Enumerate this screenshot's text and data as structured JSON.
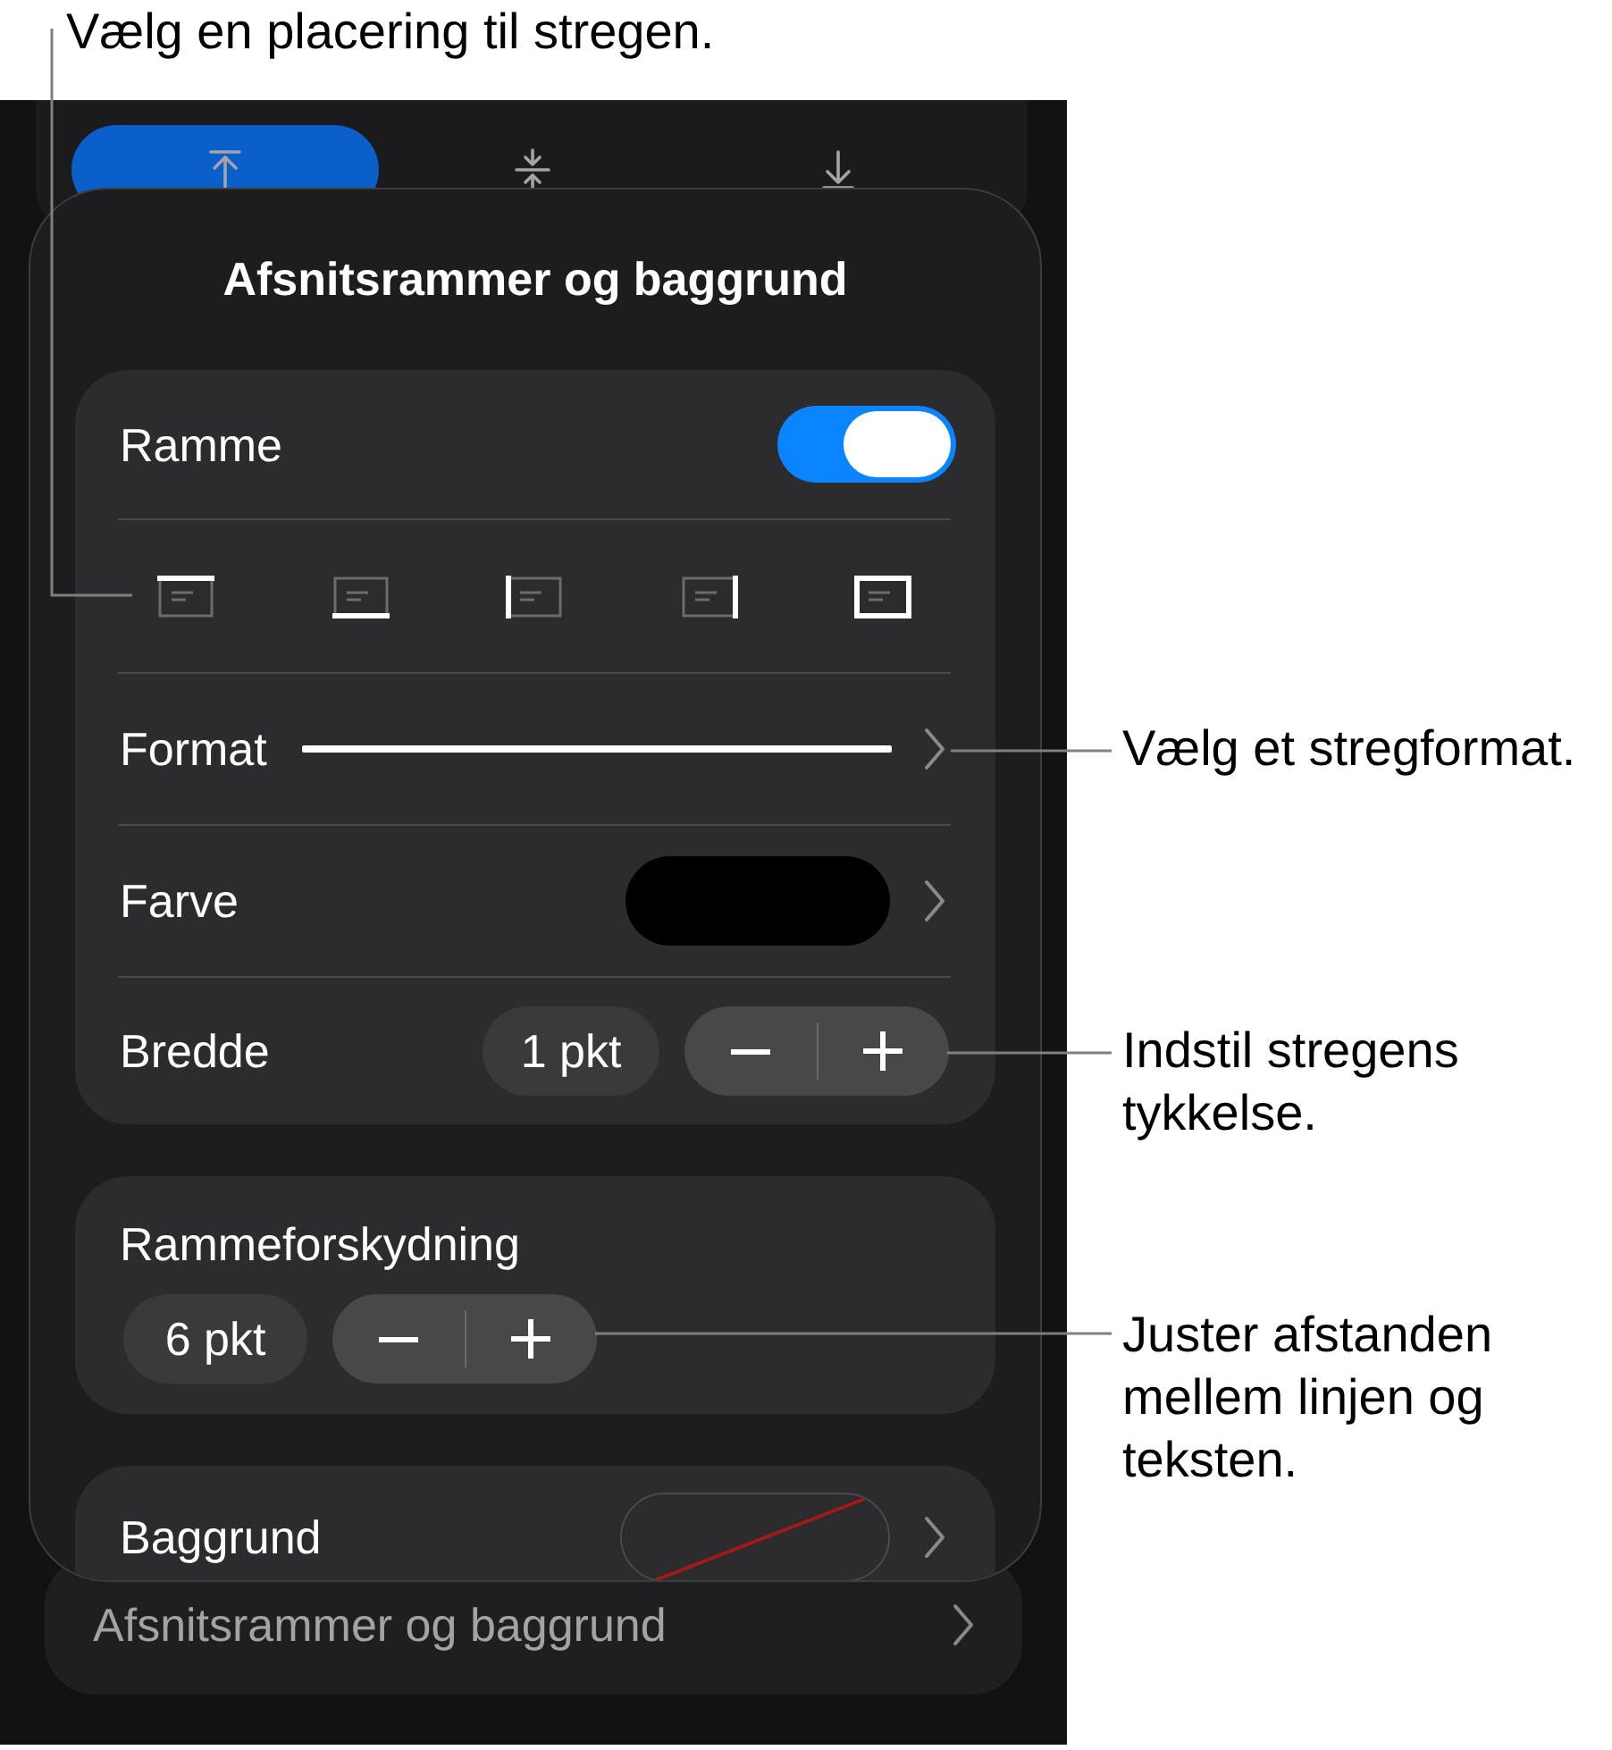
{
  "callouts": [
    {
      "text": "Vælg en placering til stregen."
    },
    {
      "text": "Vælg et stregformat."
    },
    {
      "text": "Indstil stregens tykkelse."
    },
    {
      "text": "Juster afstanden mellem linjen og teksten."
    }
  ],
  "alignment_buttons": [
    {
      "kind": "top",
      "selected": true
    },
    {
      "kind": "middle",
      "selected": false
    },
    {
      "kind": "bottom",
      "selected": false
    }
  ],
  "popover": {
    "title": "Afsnitsrammer og baggrund",
    "border_card": {
      "toggle_row": {
        "label": "Ramme",
        "on": true
      },
      "position_buttons": [
        {
          "kind": "top"
        },
        {
          "kind": "bottom"
        },
        {
          "kind": "left"
        },
        {
          "kind": "right"
        },
        {
          "kind": "all"
        }
      ],
      "format_row": {
        "label": "Format"
      },
      "color_row": {
        "label": "Farve",
        "color": "#000000"
      },
      "width_row": {
        "label": "Bredde",
        "value": "1 pkt"
      }
    },
    "offset_card": {
      "label": "Rammeforskydning",
      "value": "6 pkt"
    },
    "background_row": {
      "label": "Baggrund",
      "no_fill": true
    }
  },
  "menu_row": {
    "label": "Afsnitsrammer og baggrund"
  }
}
